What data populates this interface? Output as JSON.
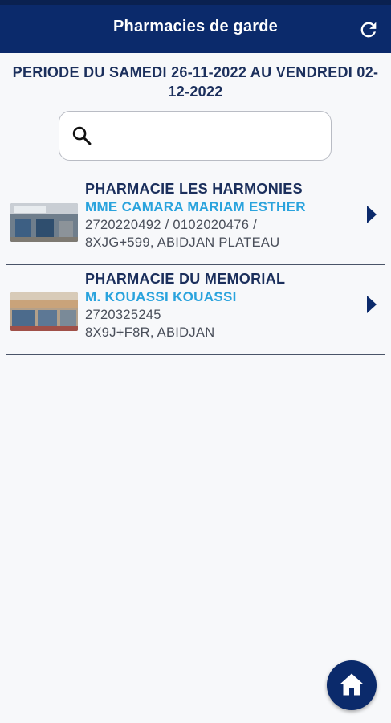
{
  "header": {
    "title": "Pharmacies de garde"
  },
  "period": {
    "text": "PERIODE DU SAMEDI 26-11-2022 AU VENDREDI 02-12-2022"
  },
  "search": {
    "value": "",
    "placeholder": ""
  },
  "pharmacies": [
    {
      "name": "PHARMACIE LES HARMONIES",
      "owner": "MME CAMARA MARIAM ESTHER",
      "phones": "2720220492 / 0102020476 /",
      "address": "8XJG+599, ABIDJAN PLATEAU"
    },
    {
      "name": "PHARMACIE DU MEMORIAL",
      "owner": "M. KOUASSI KOUASSI",
      "phones": "2720325245",
      "address": "8X9J+F8R, ABIDJAN"
    }
  ],
  "icons": {
    "refresh": "refresh-icon",
    "search": "search-icon",
    "chevron": "chevron-right-icon",
    "home": "home-icon"
  },
  "colors": {
    "header_bg": "#0b2a6b",
    "title_text": "#1b2f5c",
    "owner_text": "#2aa3dd"
  }
}
